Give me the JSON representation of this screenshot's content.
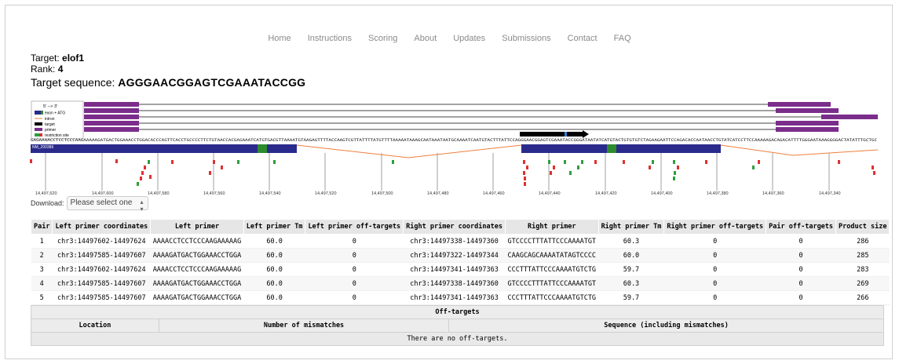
{
  "nav": [
    "Home",
    "Instructions",
    "Scoring",
    "About",
    "Updates",
    "Submissions",
    "Contact",
    "FAQ"
  ],
  "target": {
    "label": "Target:",
    "value": "elof1"
  },
  "rank": {
    "label": "Rank:",
    "value": "4"
  },
  "sequence": {
    "label": "Target sequence:",
    "value": "AGGGAACGGAGTCGAAATACCGG"
  },
  "legend": {
    "title": "5' --> 3'",
    "items": [
      "exon + ATG",
      "intron",
      "target",
      "primer",
      "restriction site"
    ]
  },
  "transcript_label": "NM_200386",
  "genome_sequence": "GAGAAAACCTCCTCCCAAGAAAAAGATGACTGGAAACCTGGACACCCAGTTCACCTGCCCCTTCTGTAACCACGAGAAATCATGTGACGTTAAAATGTAAGAGTTTTACCAAGTCGTTATTTTATGTTTTAAAAATAAAGCAATAAATAATGCAAAATCAATGTACTTTATTCCAGGGAACGGAGTCGAAATACCGGGATAATATCATGTACTGTGTGTCTAGAAGAATTCCAGACACCAATAACCTGTATCATCCTTCCAAAAAGACAGACATTTTGGGAATAAAGGGGACTATATTTGCTGC",
  "axis_ticks": [
    "14,497,620",
    "14,497,600",
    "14,497,580",
    "14,497,560",
    "14,497,540",
    "14,497,520",
    "14,497,500",
    "14,497,480",
    "14,497,460",
    "14,497,440",
    "14,497,420",
    "14,497,400",
    "14,497,380",
    "14,497,360",
    "14,497,340"
  ],
  "download": {
    "label": "Download:",
    "placeholder": "Please select one"
  },
  "primer_table": {
    "headers": [
      "Pair",
      "Left primer coordinates",
      "Left primer",
      "Left primer Tm",
      "Left primer off-targets",
      "Right primer coordinates",
      "Right primer",
      "Right primer Tm",
      "Right primer off-targets",
      "Pair off-targets",
      "Product size"
    ],
    "rows": [
      [
        "1",
        "chr3:14497602-14497624",
        "AAAACCTCCTCCCAAGAAAAAG",
        "60.0",
        "0",
        "chr3:14497338-14497360",
        "GTCCCCTTTATTCCCAAAATGT",
        "60.3",
        "0",
        "0",
        "286"
      ],
      [
        "2",
        "chr3:14497585-14497607",
        "AAAAGATGACTGGAAACCTGGA",
        "60.0",
        "0",
        "chr3:14497322-14497344",
        "CAAGCAGCAAAATATAGTCCCC",
        "60.0",
        "0",
        "0",
        "285"
      ],
      [
        "3",
        "chr3:14497602-14497624",
        "AAAACCTCCTCCCAAGAAAAAG",
        "60.0",
        "0",
        "chr3:14497341-14497363",
        "CCCTTTATTCCCAAAATGTCTG",
        "59.7",
        "0",
        "0",
        "283"
      ],
      [
        "4",
        "chr3:14497585-14497607",
        "AAAAGATGACTGGAAACCTGGA",
        "60.0",
        "0",
        "chr3:14497338-14497360",
        "GTCCCCTTTATTCCCAAAATGT",
        "60.3",
        "0",
        "0",
        "269"
      ],
      [
        "5",
        "chr3:14497585-14497607",
        "AAAAGATGACTGGAAACCTGGA",
        "60.0",
        "0",
        "chr3:14497341-14497363",
        "CCCTTTATTCCCAAAATGTCTG",
        "59.7",
        "0",
        "0",
        "266"
      ]
    ]
  },
  "offtargets": {
    "title": "Off-targets",
    "headers": [
      "Location",
      "Number of mismatches",
      "Sequence (including mismatches)"
    ],
    "empty": "There are no off-targets."
  },
  "colors": {
    "exon": "#2a2a8c",
    "exon_atg": "#2e8b2e",
    "primer": "#7b2d8b",
    "intron": "#f07f3c",
    "target": "#000000",
    "restriction_green": "#2e9e3e",
    "restriction_red": "#e03030"
  }
}
